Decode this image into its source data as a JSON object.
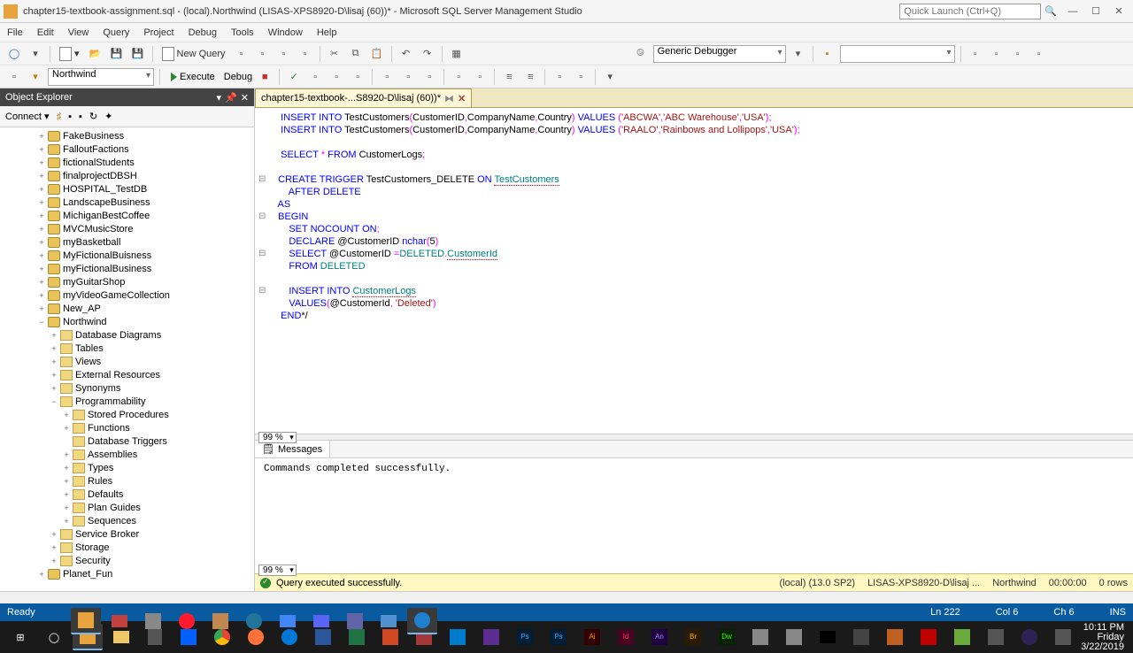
{
  "title": "chapter15-textbook-assignment.sql - (local).Northwind (LISAS-XPS8920-D\\lisaj (60))* - Microsoft SQL Server Management Studio",
  "quicklaunch": "Quick Launch (Ctrl+Q)",
  "menu": [
    "File",
    "Edit",
    "View",
    "Query",
    "Project",
    "Debug",
    "Tools",
    "Window",
    "Help"
  ],
  "toolbar": {
    "newquery": "New Query",
    "debugger": "Generic Debugger"
  },
  "toolbar2": {
    "db": "Northwind",
    "execute": "Execute",
    "debug": "Debug"
  },
  "oe": {
    "title": "Object Explorer",
    "connect": "Connect",
    "nodes": [
      {
        "d": 3,
        "e": "+",
        "t": "db",
        "l": "FakeBusiness"
      },
      {
        "d": 3,
        "e": "+",
        "t": "db",
        "l": "FalloutFactions"
      },
      {
        "d": 3,
        "e": "+",
        "t": "db",
        "l": "fictionalStudents"
      },
      {
        "d": 3,
        "e": "+",
        "t": "db",
        "l": "finalprojectDBSH"
      },
      {
        "d": 3,
        "e": "+",
        "t": "db",
        "l": "HOSPITAL_TestDB"
      },
      {
        "d": 3,
        "e": "+",
        "t": "db",
        "l": "LandscapeBusiness"
      },
      {
        "d": 3,
        "e": "+",
        "t": "db",
        "l": "MichiganBestCoffee"
      },
      {
        "d": 3,
        "e": "+",
        "t": "db",
        "l": "MVCMusicStore"
      },
      {
        "d": 3,
        "e": "+",
        "t": "db",
        "l": "myBasketball"
      },
      {
        "d": 3,
        "e": "+",
        "t": "db",
        "l": "MyFictionalBuisness"
      },
      {
        "d": 3,
        "e": "+",
        "t": "db",
        "l": "myFictionalBusiness"
      },
      {
        "d": 3,
        "e": "+",
        "t": "db",
        "l": "myGuitarShop"
      },
      {
        "d": 3,
        "e": "+",
        "t": "db",
        "l": "myVideoGameCollection"
      },
      {
        "d": 3,
        "e": "+",
        "t": "db",
        "l": "New_AP"
      },
      {
        "d": 3,
        "e": "−",
        "t": "db",
        "l": "Northwind"
      },
      {
        "d": 4,
        "e": "+",
        "t": "fld",
        "l": "Database Diagrams"
      },
      {
        "d": 4,
        "e": "+",
        "t": "fld",
        "l": "Tables"
      },
      {
        "d": 4,
        "e": "+",
        "t": "fld",
        "l": "Views"
      },
      {
        "d": 4,
        "e": "+",
        "t": "fld",
        "l": "External Resources"
      },
      {
        "d": 4,
        "e": "+",
        "t": "fld",
        "l": "Synonyms"
      },
      {
        "d": 4,
        "e": "−",
        "t": "fld",
        "l": "Programmability"
      },
      {
        "d": 5,
        "e": "+",
        "t": "fld",
        "l": "Stored Procedures"
      },
      {
        "d": 5,
        "e": "+",
        "t": "fld",
        "l": "Functions"
      },
      {
        "d": 5,
        "e": "",
        "t": "fld",
        "l": "Database Triggers"
      },
      {
        "d": 5,
        "e": "+",
        "t": "fld",
        "l": "Assemblies"
      },
      {
        "d": 5,
        "e": "+",
        "t": "fld",
        "l": "Types"
      },
      {
        "d": 5,
        "e": "+",
        "t": "fld",
        "l": "Rules"
      },
      {
        "d": 5,
        "e": "+",
        "t": "fld",
        "l": "Defaults"
      },
      {
        "d": 5,
        "e": "+",
        "t": "fld",
        "l": "Plan Guides"
      },
      {
        "d": 5,
        "e": "+",
        "t": "fld",
        "l": "Sequences"
      },
      {
        "d": 4,
        "e": "+",
        "t": "fld",
        "l": "Service Broker"
      },
      {
        "d": 4,
        "e": "+",
        "t": "fld",
        "l": "Storage"
      },
      {
        "d": 4,
        "e": "+",
        "t": "fld",
        "l": "Security"
      },
      {
        "d": 3,
        "e": "+",
        "t": "db",
        "l": "Planet_Fun"
      }
    ]
  },
  "tab": {
    "label": "chapter15-textbook-...S8920-D\\lisaj (60))*"
  },
  "zoom": "99 %",
  "messages": {
    "tab": "Messages",
    "body": "Commands completed successfully."
  },
  "execstatus": {
    "msg": "Query executed successfully.",
    "server": "(local) (13.0 SP2)",
    "login": "LISAS-XPS8920-D\\lisaj ...",
    "db": "Northwind",
    "time": "00:00:00",
    "rows": "0 rows"
  },
  "status": {
    "ready": "Ready",
    "ln": "Ln 222",
    "col": "Col 6",
    "ch": "Ch 6",
    "ins": "INS"
  },
  "clock": {
    "time": "10:11 PM",
    "day": "Friday",
    "date": "3/22/2019"
  }
}
